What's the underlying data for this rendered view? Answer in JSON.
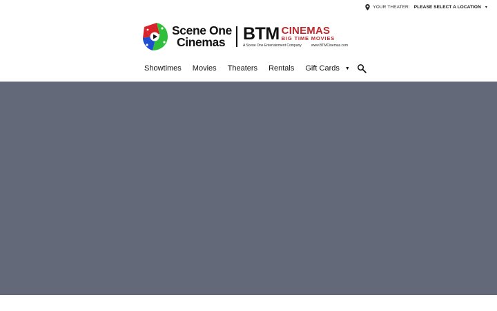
{
  "topbar": {
    "theater_label": "YOUR THEATER:",
    "theater_value": "PLEASE SELECT A LOCATION",
    "icons": {
      "location": "location-pin-icon",
      "dropdown": "caret-down-icon"
    }
  },
  "logo": {
    "scene_one_line1": "Scene One",
    "scene_one_line2": "Cinemas",
    "btm": "BTM",
    "cinemas": "CINEMAS",
    "big_time_movies": "BIG TIME MOVIES",
    "tagline_left": "A Scene One Entertainment Company",
    "tagline_right": "www.BTMCinemas.com",
    "colors": {
      "red": "#c0282d",
      "reel_green": "#2fbf3a",
      "reel_blue": "#1f4fd0",
      "reel_red": "#d8232a"
    }
  },
  "nav": {
    "items": [
      {
        "label": "Showtimes"
      },
      {
        "label": "Movies"
      },
      {
        "label": "Theaters"
      },
      {
        "label": "Rentals"
      },
      {
        "label": "Gift Cards",
        "has_dropdown": true
      }
    ],
    "search_icon": "search-icon"
  },
  "hero": {
    "background": "#646979"
  }
}
